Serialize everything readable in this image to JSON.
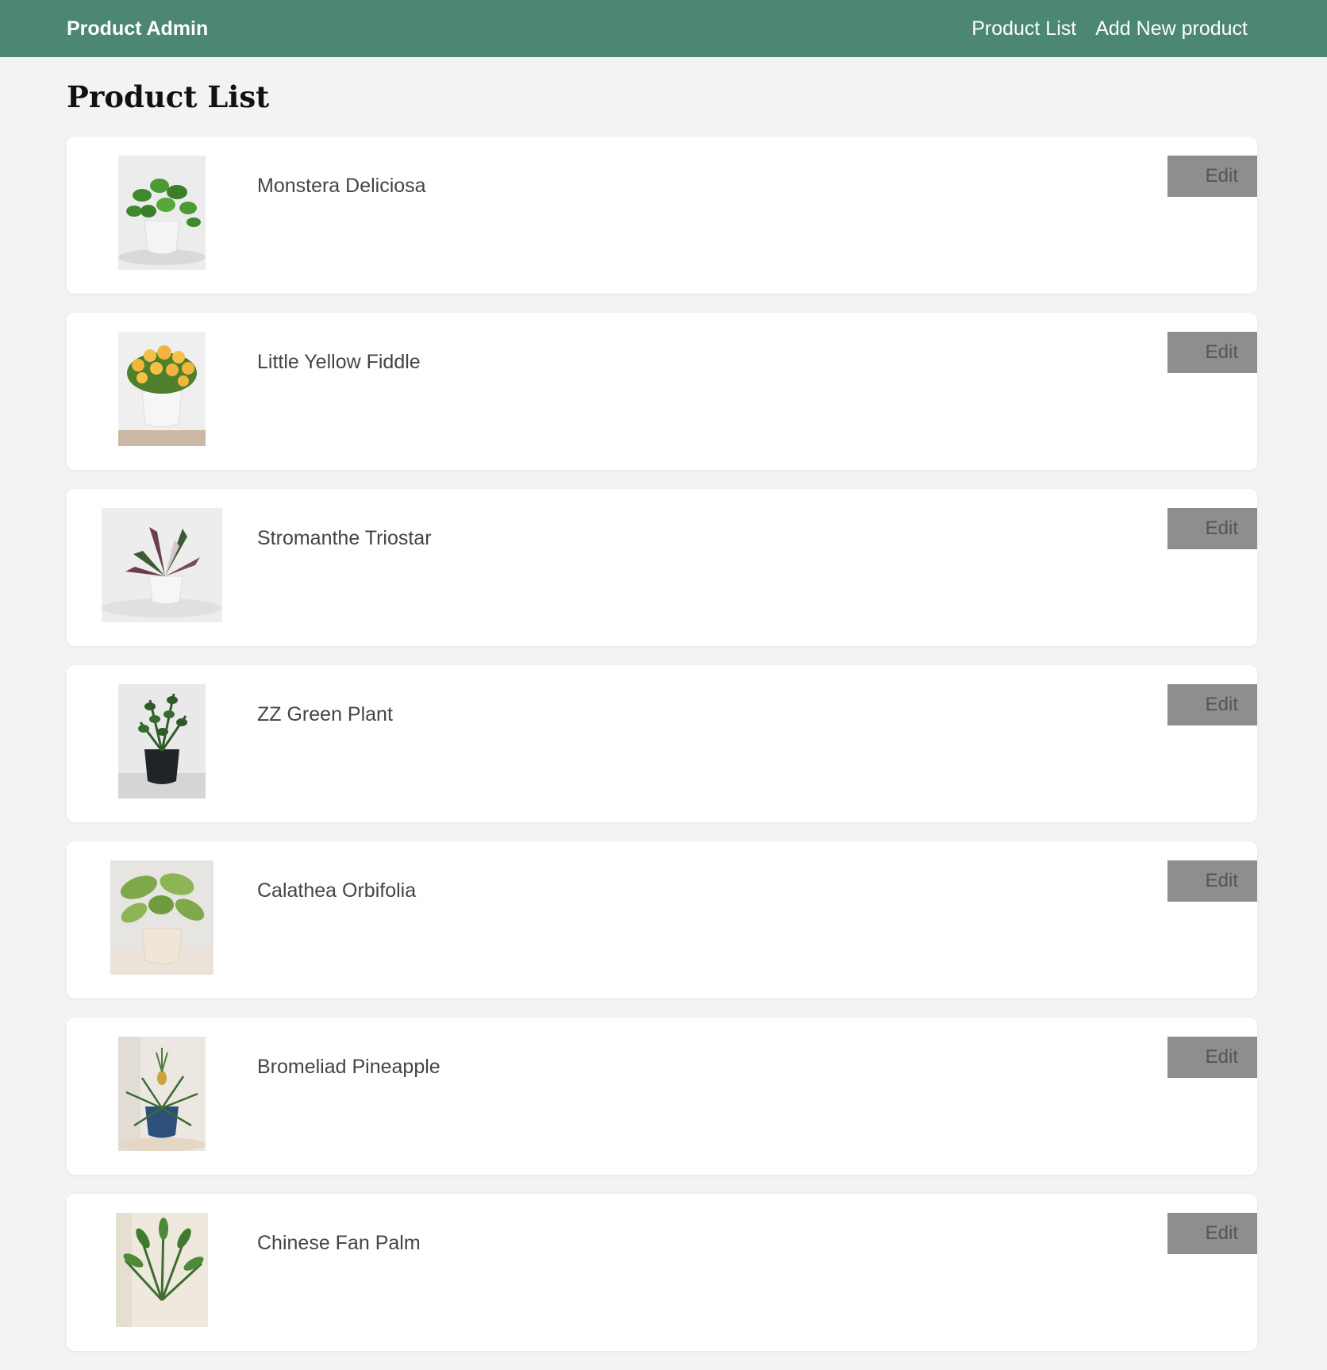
{
  "header": {
    "brand": "Product Admin",
    "nav": [
      "Product List",
      "Add New product"
    ]
  },
  "page": {
    "title": "Product List"
  },
  "products": [
    {
      "name": "Monstera Deliciosa",
      "edit_label": "Edit"
    },
    {
      "name": "Little Yellow Fiddle",
      "edit_label": "Edit"
    },
    {
      "name": "Stromanthe Triostar",
      "edit_label": "Edit"
    },
    {
      "name": "ZZ Green Plant",
      "edit_label": "Edit"
    },
    {
      "name": "Calathea Orbifolia",
      "edit_label": "Edit"
    },
    {
      "name": "Bromeliad Pineapple",
      "edit_label": "Edit"
    },
    {
      "name": "Chinese Fan Palm",
      "edit_label": "Edit"
    }
  ],
  "colors": {
    "header_bg": "#4b8772",
    "page_bg": "#f3f3f3",
    "button_bg": "#8e8e8e"
  }
}
